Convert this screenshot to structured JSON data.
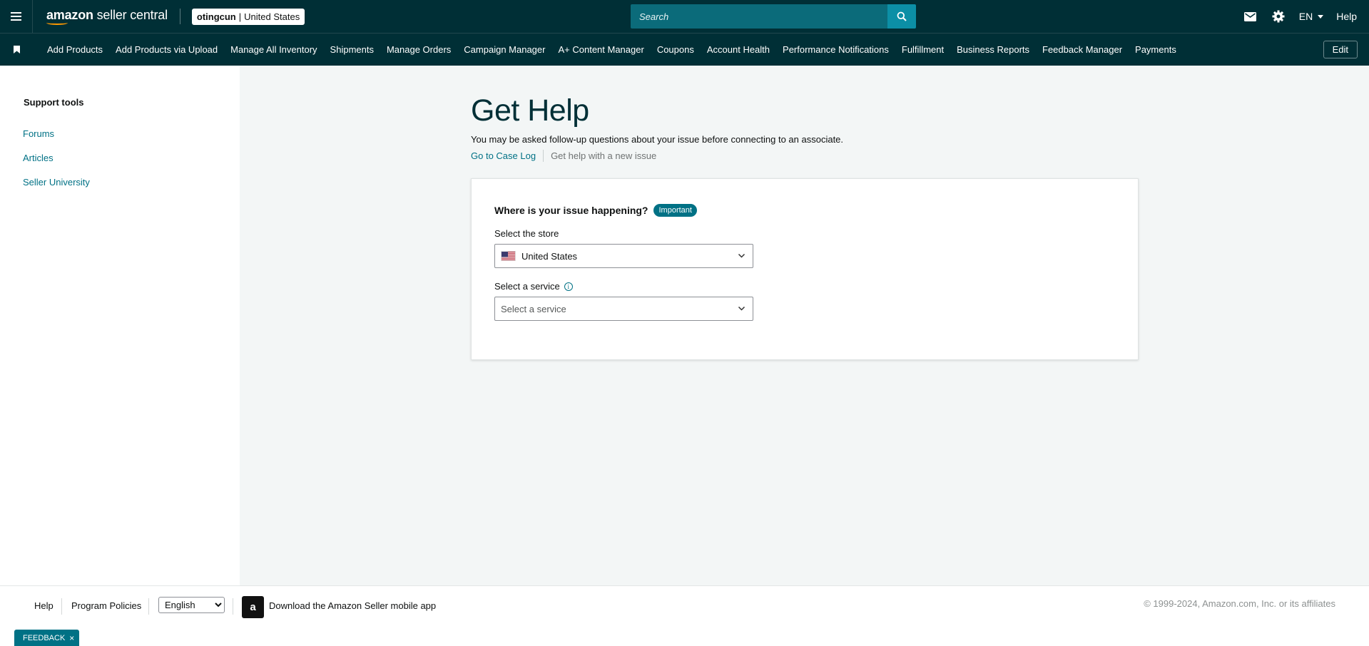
{
  "header": {
    "menu_icon": "hamburger-menu-icon",
    "logo_text_bold": "amazon",
    "logo_text": " seller central",
    "account": {
      "name": "otingcun",
      "separator": "|",
      "marketplace": "United States"
    },
    "search": {
      "placeholder": "Search"
    },
    "icons": [
      "mail-icon",
      "gear-icon"
    ],
    "language": "EN",
    "help": "Help"
  },
  "nav": {
    "items": [
      "Add Products",
      "Add Products via Upload",
      "Manage All Inventory",
      "Shipments",
      "Manage Orders",
      "Campaign Manager",
      "A+ Content Manager",
      "Coupons",
      "Account Health",
      "Performance Notifications",
      "Fulfillment",
      "Business Reports",
      "Feedback Manager",
      "Payments"
    ],
    "edit": "Edit"
  },
  "sidebar": {
    "title": "Support tools",
    "links": [
      "Forums",
      "Articles",
      "Seller University"
    ]
  },
  "main": {
    "title": "Get Help",
    "subtitle": "You may be asked follow-up questions about your issue before connecting to an associate.",
    "case_log": "Go to Case Log",
    "new_issue": "Get help with a new issue",
    "card": {
      "question": "Where is your issue happening?",
      "badge": "Important",
      "store_label": "Select the store",
      "store_value": "United States",
      "service_label": "Select a service",
      "service_placeholder": "Select a service"
    }
  },
  "footer": {
    "help": "Help",
    "program_policies": "Program Policies",
    "language_options": [
      "English"
    ],
    "app_text": "Download the Amazon Seller mobile app",
    "copyright": "© 1999-2024, Amazon.com, Inc. or its affiliates"
  },
  "feedback": {
    "label": "FEEDBACK",
    "close": "×"
  },
  "colors": {
    "header_bg": "#002f36",
    "accent": "#007185",
    "search_bg": "#0b6b7a"
  }
}
